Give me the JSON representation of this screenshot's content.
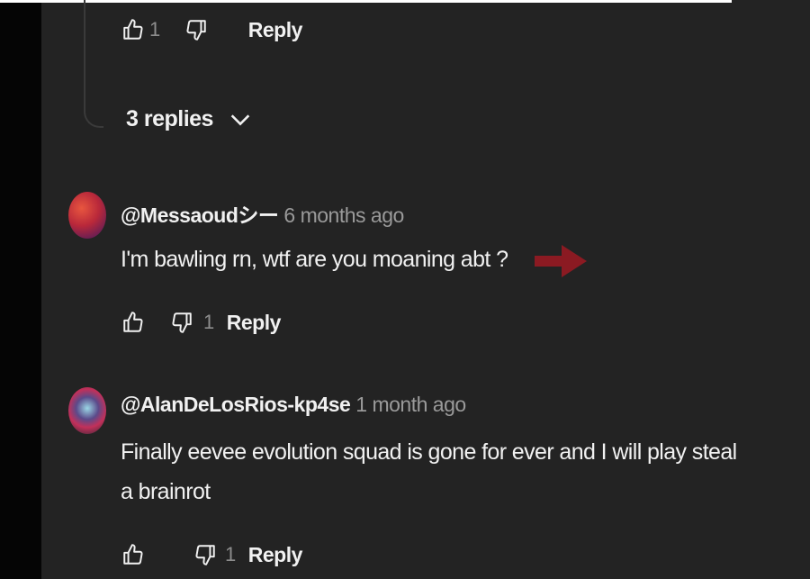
{
  "top_actions": {
    "like_count": "1",
    "reply_label": "Reply"
  },
  "replies_toggle": {
    "label": "3 replies"
  },
  "comments": [
    {
      "author": "@Messaoudシー",
      "time": "6 months ago",
      "text": "I'm bawling rn, wtf are you moaning abt ?",
      "dislike_count": "1",
      "reply_label": "Reply"
    },
    {
      "author": "@AlanDeLosRios-kp4se",
      "time": "1 month ago",
      "text": "Finally eevee evolution squad is gone for ever and I will play steal a brainrot",
      "dislike_count": "1",
      "reply_label": "Reply"
    }
  ],
  "icons": [
    "thumb-up-icon",
    "thumb-down-icon",
    "chevron-down-icon",
    "arrow-right-icon"
  ],
  "colors": {
    "background": "#232323",
    "text": "#f1f1f1",
    "muted": "#9a9a9a",
    "annotation_arrow": "#8b1a22"
  }
}
